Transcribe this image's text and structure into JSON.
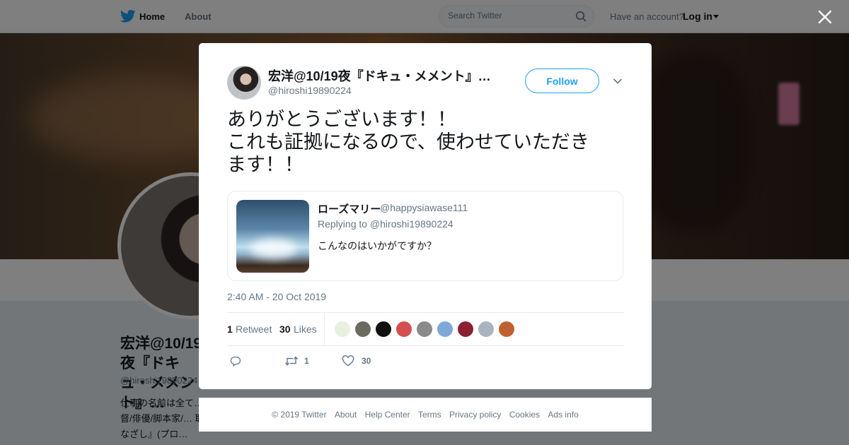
{
  "nav": {
    "home_label": "Home",
    "about_label": "About",
    "search_placeholder": "Search Twitter",
    "have_account": "Have an account?",
    "login_label": "Log in"
  },
  "profile_bg": {
    "name": "宏洋@10/19夜『ドキュ・メメント』…",
    "handle": "@hiroshi19890224",
    "bio": "仕事の名前は全て… す。大川は邪魔な… 監督/俳優/脚本家/… 取締役社長/映画『君のまなざし』(プロ…"
  },
  "tweet": {
    "author_name": "宏洋@10/19夜『ドキュ・メメント』…",
    "author_handle": "@hiroshi19890224",
    "follow_label": "Follow",
    "text": "ありがとうございます！！\nこれも証拠になるので、使わせていただき\nます！！",
    "quote": {
      "name": "ローズマリー",
      "handle": "@happysiawase111",
      "replying_to": "Replying to @hiroshi19890224",
      "text": "こんなのはいかがですか？"
    },
    "timestamp": "2:40 AM - 20 Oct 2019",
    "retweet_count": "1",
    "retweet_label": "Retweet",
    "like_count": "30",
    "like_label": "Likes",
    "action_retweets": "1",
    "action_likes": "30"
  },
  "likers": [
    {
      "color": "#e8f0e0"
    },
    {
      "color": "#6b6b60"
    },
    {
      "color": "#111111"
    },
    {
      "color": "#d45050"
    },
    {
      "color": "#8a8a8a"
    },
    {
      "color": "#7fa8d8"
    },
    {
      "color": "#8a2030"
    },
    {
      "color": "#aab4c0"
    },
    {
      "color": "#c06030"
    }
  ],
  "footer": {
    "copyright": "© 2019 Twitter",
    "about": "About",
    "help": "Help Center",
    "terms": "Terms",
    "privacy": "Privacy policy",
    "cookies": "Cookies",
    "ads": "Ads info"
  },
  "colors": {
    "accent": "#1da1f2",
    "muted": "#657786"
  }
}
